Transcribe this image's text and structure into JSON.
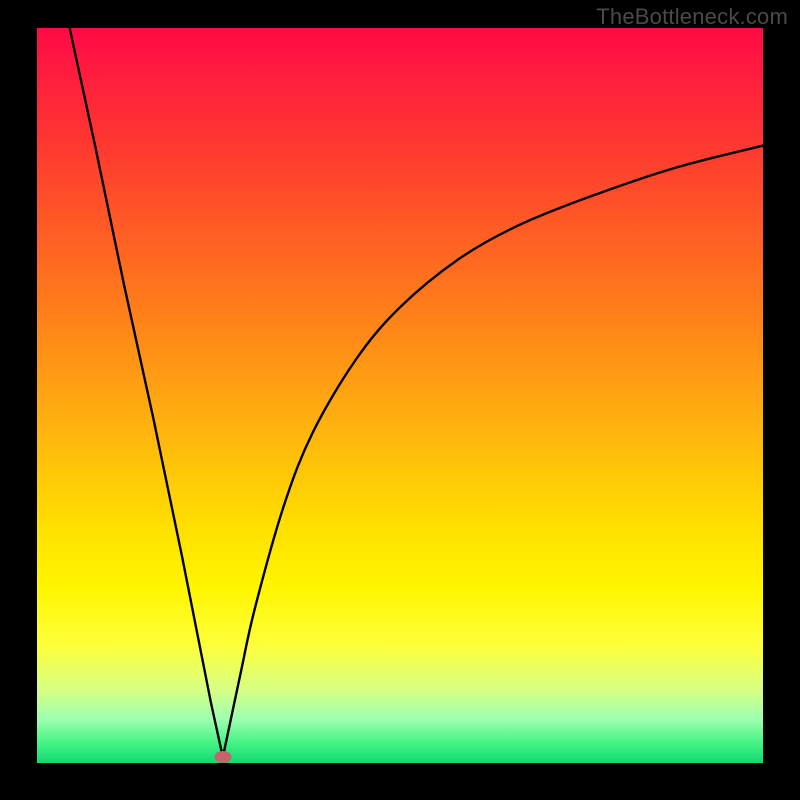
{
  "watermark": "TheBottleneck.com",
  "chart_data": {
    "type": "line",
    "title": "",
    "xlabel": "",
    "ylabel": "",
    "xlim": [
      0,
      100
    ],
    "ylim": [
      0,
      100
    ],
    "grid": false,
    "legend": false,
    "description": "V-shaped bottleneck curve over rainbow gradient; minimum near x≈26 at y≈0; left branch nearly linear steep descent from (4.5,100); right branch concave rising toward (100,84).",
    "series": [
      {
        "name": "left-branch",
        "x": [
          4.5,
          8,
          12,
          16,
          20,
          24,
          25.6
        ],
        "values": [
          100,
          84,
          65,
          47,
          28,
          8,
          0.8
        ]
      },
      {
        "name": "right-branch",
        "x": [
          25.6,
          28,
          30,
          34,
          38,
          44,
          50,
          58,
          66,
          76,
          88,
          100
        ],
        "values": [
          0.8,
          12,
          21,
          35,
          45,
          55,
          62,
          68.5,
          73,
          77,
          81,
          84
        ]
      }
    ],
    "marker": {
      "x": 25.6,
      "y": 0.85
    },
    "gradient_stops": [
      {
        "pct": 0,
        "color": "#ff0a45"
      },
      {
        "pct": 14,
        "color": "#ff3232"
      },
      {
        "pct": 32,
        "color": "#ff6a20"
      },
      {
        "pct": 55,
        "color": "#ffb50e"
      },
      {
        "pct": 76,
        "color": "#fff500"
      },
      {
        "pct": 94,
        "color": "#9dffb0"
      },
      {
        "pct": 100,
        "color": "#1bd671"
      }
    ]
  }
}
